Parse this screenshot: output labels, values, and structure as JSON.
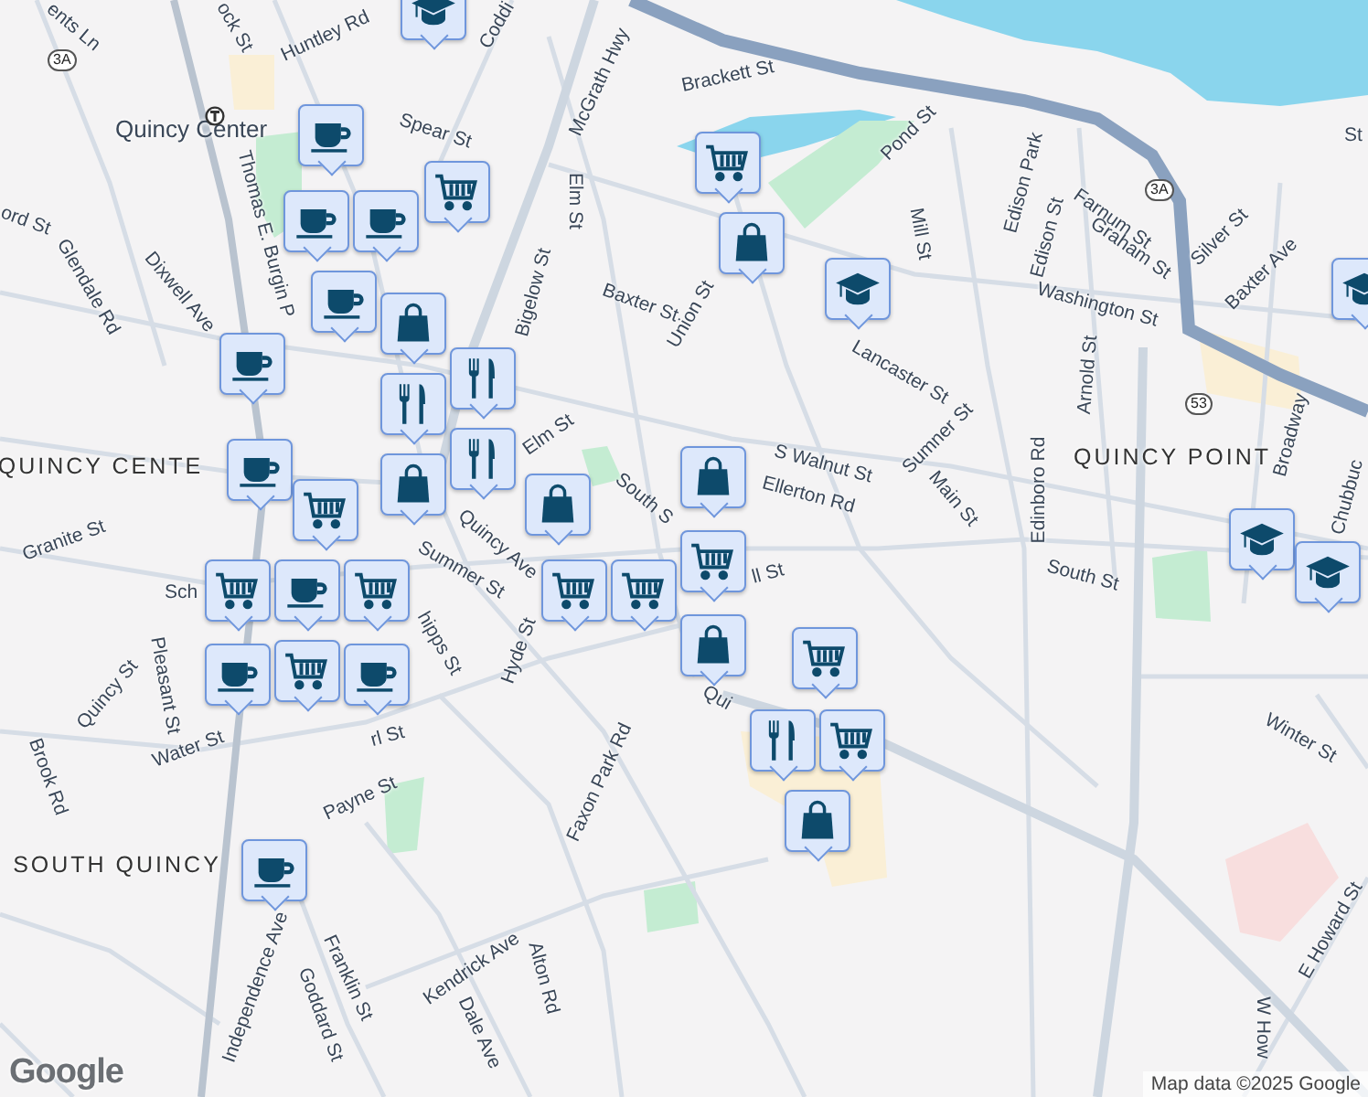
{
  "labels": [
    {
      "text": "ents Ln",
      "kind": "street"
    },
    {
      "text": "ock St",
      "kind": "street"
    },
    {
      "text": "Huntley Rd",
      "kind": "street"
    },
    {
      "text": "Coddi",
      "kind": "street"
    },
    {
      "text": "Brackett St",
      "kind": "street"
    },
    {
      "text": "Quincy Center",
      "kind": "station"
    },
    {
      "text": "Spear St",
      "kind": "street"
    },
    {
      "text": "McGrath Hwy",
      "kind": "street"
    },
    {
      "text": "Elm St",
      "kind": "street"
    },
    {
      "text": "Pond St",
      "kind": "street"
    },
    {
      "text": "Mill St",
      "kind": "street"
    },
    {
      "text": "Edison Park",
      "kind": "street"
    },
    {
      "text": "Edison St",
      "kind": "street"
    },
    {
      "text": "Farnum St",
      "kind": "street"
    },
    {
      "text": "Graham St",
      "kind": "street"
    },
    {
      "text": "Silver St",
      "kind": "street"
    },
    {
      "text": "Baxter Ave",
      "kind": "street"
    },
    {
      "text": "St",
      "kind": "street"
    },
    {
      "text": "ord St",
      "kind": "street"
    },
    {
      "text": "Glendale Rd",
      "kind": "street"
    },
    {
      "text": "Dixwell Ave",
      "kind": "street"
    },
    {
      "text": "Thomas E. Burgin P",
      "kind": "street"
    },
    {
      "text": "Bigelow St",
      "kind": "street"
    },
    {
      "text": "Baxter St",
      "kind": "street"
    },
    {
      "text": "Union St",
      "kind": "street"
    },
    {
      "text": "Washington St",
      "kind": "street"
    },
    {
      "text": "Lancaster St",
      "kind": "street"
    },
    {
      "text": "Sumner St",
      "kind": "street"
    },
    {
      "text": "S Walnut St",
      "kind": "street"
    },
    {
      "text": "Ellerton Rd",
      "kind": "street"
    },
    {
      "text": "Main St",
      "kind": "street"
    },
    {
      "text": "Edinboro Rd",
      "kind": "street"
    },
    {
      "text": "Arnold St",
      "kind": "street"
    },
    {
      "text": "QUINCY POINT",
      "kind": "area"
    },
    {
      "text": "Broadway",
      "kind": "street"
    },
    {
      "text": "Chubbuc",
      "kind": "street"
    },
    {
      "text": "QUINCY CENTE",
      "kind": "area"
    },
    {
      "text": "Elm St",
      "kind": "street"
    },
    {
      "text": "South S",
      "kind": "street"
    },
    {
      "text": "Granite St",
      "kind": "street"
    },
    {
      "text": "Quincy Ave",
      "kind": "street"
    },
    {
      "text": "Summer St",
      "kind": "street"
    },
    {
      "text": "Sch",
      "kind": "street"
    },
    {
      "text": "hipps St",
      "kind": "street"
    },
    {
      "text": "Hyde St",
      "kind": "street"
    },
    {
      "text": "Quincy St",
      "kind": "street"
    },
    {
      "text": "Pleasant St",
      "kind": "street"
    },
    {
      "text": "Water St",
      "kind": "street"
    },
    {
      "text": "rl St",
      "kind": "street"
    },
    {
      "text": "ll St",
      "kind": "street"
    },
    {
      "text": "Qui",
      "kind": "street"
    },
    {
      "text": "Brook Rd",
      "kind": "street"
    },
    {
      "text": "Payne St",
      "kind": "street"
    },
    {
      "text": "SOUTH QUINCY",
      "kind": "area"
    },
    {
      "text": "Faxon Park Rd",
      "kind": "street"
    },
    {
      "text": "Independence Ave",
      "kind": "street"
    },
    {
      "text": "Goddard St",
      "kind": "street"
    },
    {
      "text": "Franklin St",
      "kind": "street"
    },
    {
      "text": "Kendrick Ave",
      "kind": "street"
    },
    {
      "text": "Dale Ave",
      "kind": "street"
    },
    {
      "text": "Alton Rd",
      "kind": "street"
    },
    {
      "text": "South St",
      "kind": "street"
    },
    {
      "text": "Winter St",
      "kind": "street"
    },
    {
      "text": "E Howard St",
      "kind": "street"
    },
    {
      "text": "W How",
      "kind": "street"
    }
  ],
  "shields": [
    "3A",
    "3A",
    "53"
  ],
  "pins": [
    {
      "kind": "school"
    },
    {
      "kind": "cafe"
    },
    {
      "kind": "grocery"
    },
    {
      "kind": "cafe"
    },
    {
      "kind": "cafe"
    },
    {
      "kind": "cafe"
    },
    {
      "kind": "grocery"
    },
    {
      "kind": "shop"
    },
    {
      "kind": "school"
    },
    {
      "kind": "shop"
    },
    {
      "kind": "restaurant"
    },
    {
      "kind": "restaurant"
    },
    {
      "kind": "restaurant"
    },
    {
      "kind": "cafe"
    },
    {
      "kind": "shop"
    },
    {
      "kind": "cafe"
    },
    {
      "kind": "grocery"
    },
    {
      "kind": "shop"
    },
    {
      "kind": "grocery"
    },
    {
      "kind": "grocery"
    },
    {
      "kind": "grocery"
    },
    {
      "kind": "shop"
    },
    {
      "kind": "shop"
    },
    {
      "kind": "cafe"
    },
    {
      "kind": "grocery"
    },
    {
      "kind": "grocery"
    },
    {
      "kind": "grocery"
    },
    {
      "kind": "cafe"
    },
    {
      "kind": "cafe"
    },
    {
      "kind": "cafe"
    },
    {
      "kind": "grocery"
    },
    {
      "kind": "restaurant"
    },
    {
      "kind": "grocery"
    },
    {
      "kind": "shop"
    },
    {
      "kind": "school"
    },
    {
      "kind": "school"
    },
    {
      "kind": "school"
    }
  ],
  "logo": "Google",
  "attribution": "Map data ©2025 Google"
}
